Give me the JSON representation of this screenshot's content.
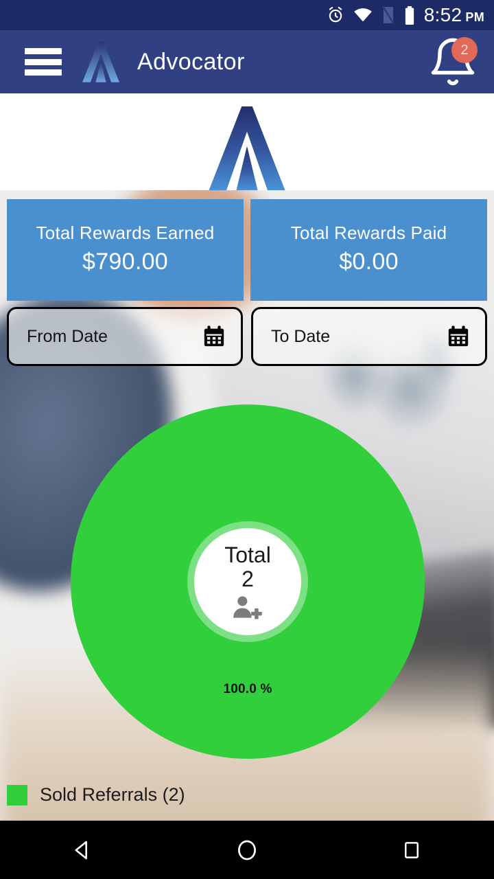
{
  "status_bar": {
    "time": "8:52",
    "meridiem": "PM",
    "icons": [
      "alarm-icon",
      "wifi-icon",
      "sim-card-icon",
      "battery-icon"
    ]
  },
  "app_bar": {
    "menu_icon": "hamburger-menu-icon",
    "logo_icon": "advocator-a-logo-icon",
    "title": "Advocator",
    "notification_icon": "bell-icon",
    "notification_count": "2",
    "badge_color": "#e0695a",
    "background_color": "#304083"
  },
  "brand": {
    "logo_icon": "advocator-a-logo-icon",
    "gradient_from": "#26306e",
    "gradient_to": "#4a92d8"
  },
  "stats": {
    "cards": [
      {
        "label": "Total Rewards Earned",
        "value": "$790.00"
      },
      {
        "label": "Total Rewards Paid",
        "value": "$0.00"
      }
    ],
    "card_color": "#4a90cf"
  },
  "filters": {
    "from_date": {
      "label": "From Date",
      "icon": "calendar-icon",
      "value": ""
    },
    "to_date": {
      "label": "To Date",
      "icon": "calendar-icon",
      "value": ""
    }
  },
  "chart_data": {
    "type": "pie",
    "title": "",
    "center_label": "Total",
    "center_value": "2",
    "center_icon": "person-add-icon",
    "categories": [
      "Sold Referrals"
    ],
    "values": [
      2
    ],
    "percent_labels": [
      "100.0 %"
    ],
    "colors": [
      "#32cf3c"
    ],
    "legend": [
      {
        "label": "Sold Referrals (2)",
        "color": "#32cf3c"
      }
    ],
    "legend_position": "bottom-left",
    "donut": true,
    "inner_ring_color": "#7ee084",
    "hole_color": "#ffffff"
  },
  "nav_bar": {
    "buttons": [
      {
        "name": "back-button",
        "icon": "triangle-left-icon"
      },
      {
        "name": "home-button",
        "icon": "circle-icon"
      },
      {
        "name": "recents-button",
        "icon": "square-icon"
      }
    ]
  }
}
